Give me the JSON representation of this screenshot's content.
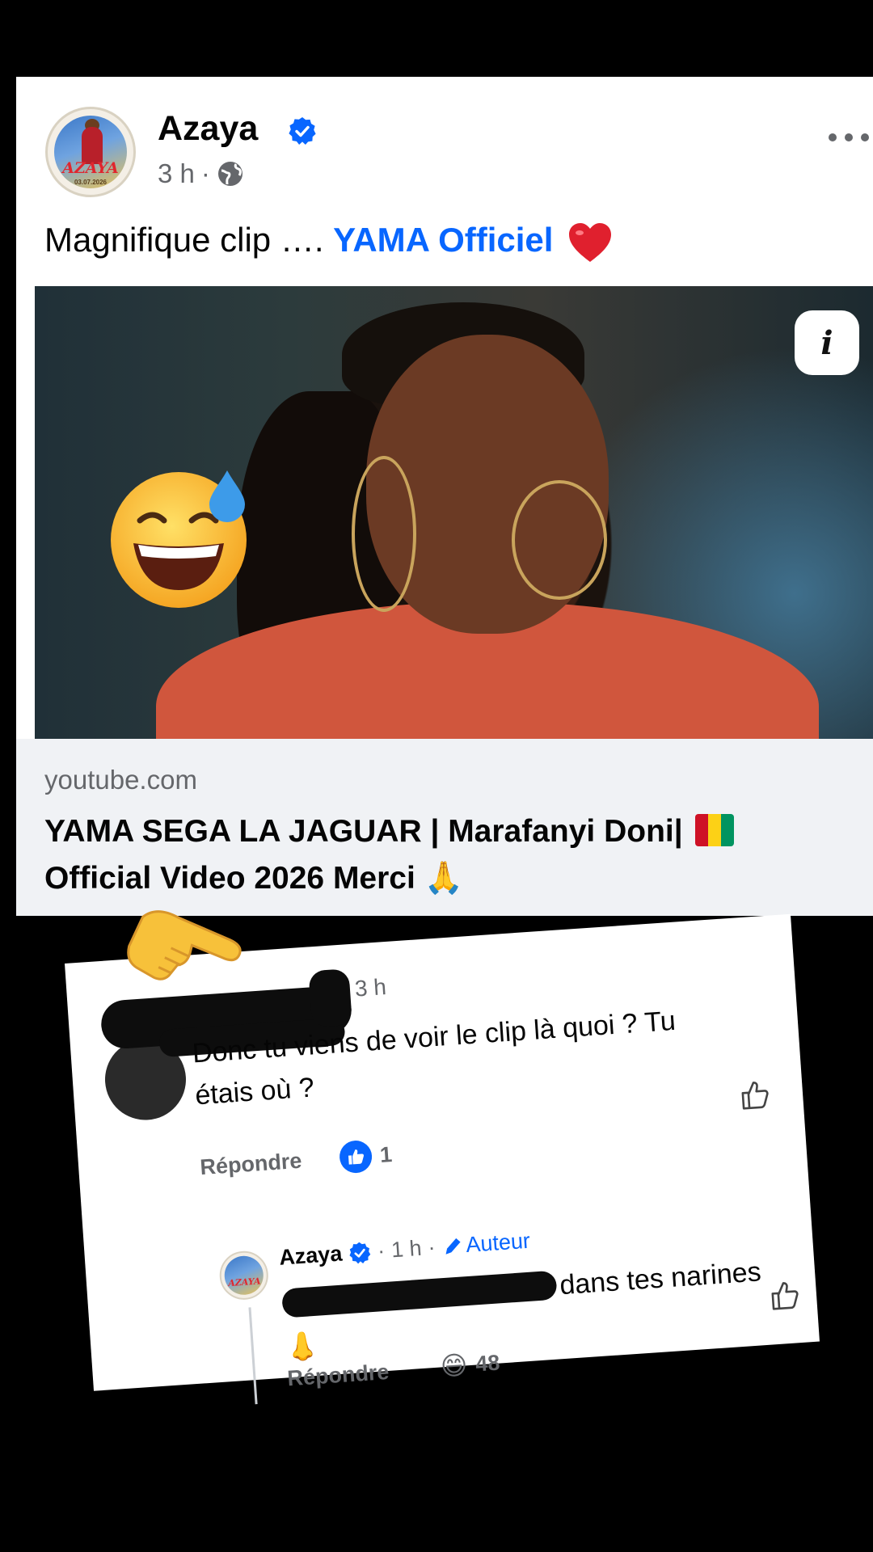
{
  "post": {
    "author": "Azaya",
    "time": "3 h",
    "meta_separator": "·",
    "avatar_text": "AZAYA",
    "avatar_date": "03.07.2026",
    "caption_text": "Magnifique clip ….",
    "caption_mention": "YAMA Officiel",
    "caption_emoji": "heart",
    "media_info_label": "i",
    "link": {
      "domain": "youtube.com",
      "title_part1": "YAMA SEGA LA JAGUAR | Marafanyi Doni|",
      "title_part2": "Official Video 2026 Merci 🙏"
    }
  },
  "overlay_emojis": [
    "grinning-sweat-emoji",
    "backhand-pointing-right-emoji"
  ],
  "comment": {
    "time": "3 h",
    "text": "Donc tu viens de voir le clip là quoi ? Tu étais où ?",
    "reply_label": "Répondre",
    "like_count": "1",
    "reply": {
      "author": "Azaya",
      "time": "1 h",
      "separator": "·",
      "badge": "Auteur",
      "text_visible": "dans tes narines",
      "emoji": "👃",
      "reply_label": "Répondre",
      "reaction_emoji": "😄",
      "reaction_count": "48"
    }
  },
  "colors": {
    "accent": "#0866ff",
    "text_primary": "#050505",
    "text_secondary": "#65676b",
    "link_bg": "#f0f2f5"
  }
}
